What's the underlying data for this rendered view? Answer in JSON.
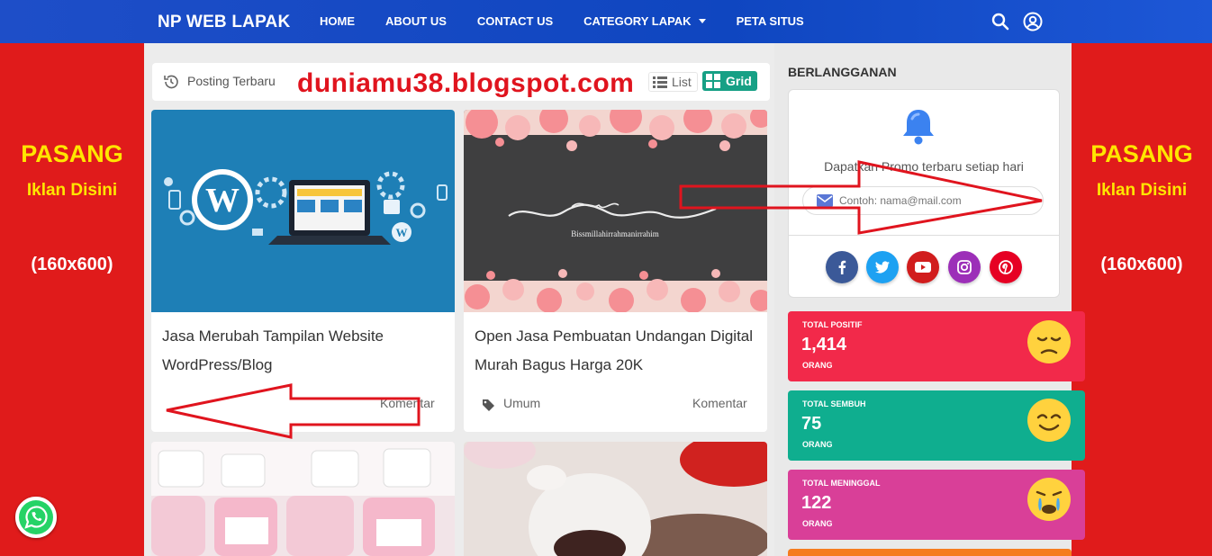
{
  "header": {
    "brand": "NP WEB LAPAK",
    "nav": [
      "HOME",
      "ABOUT US",
      "CONTACT US",
      "CATEGORY LAPAK",
      "PETA SITUS"
    ],
    "icons": [
      "search-icon",
      "user-icon"
    ]
  },
  "ads": {
    "line1": "PASANG",
    "line2": "Iklan Disini",
    "line3": "(160x600)"
  },
  "toolbar": {
    "label": "Posting Terbaru",
    "watermark": "duniamu38.blogspot.com",
    "list_label": "List",
    "grid_label": "Grid"
  },
  "posts": [
    {
      "title": "Jasa Merubah Tampilan Website WordPress/Blog",
      "category": "",
      "comments": "Komentar"
    },
    {
      "title": "Open Jasa Pembuatan Undangan Digital Murah Bagus Harga 20K",
      "category": "Umum",
      "comments": "Komentar"
    }
  ],
  "card2_image_text": "Bissmillahirrahmanirrahim",
  "sidebar": {
    "title": "BERLANGGANAN",
    "promo": "Dapatkan Promo terbaru setiap hari",
    "email_placeholder": "Contoh: nama@mail.com",
    "social": [
      "facebook-icon",
      "twitter-icon",
      "youtube-icon",
      "instagram-icon",
      "pinterest-icon"
    ]
  },
  "stats": [
    {
      "label": "TOTAL POSITIF",
      "value": "1,414",
      "unit": "ORANG",
      "color": "#f2294a"
    },
    {
      "label": "TOTAL SEMBUH",
      "value": "75",
      "unit": "ORANG",
      "color": "#0fae8f"
    },
    {
      "label": "TOTAL MENINGGAL",
      "value": "122",
      "unit": "ORANG",
      "color": "#d93f98"
    }
  ],
  "colors": {
    "header": "#1e4ec8",
    "ad": "#e01b1b",
    "ad_text": "#ffe600",
    "accent": "#16a085",
    "watermark": "#e0141e"
  }
}
